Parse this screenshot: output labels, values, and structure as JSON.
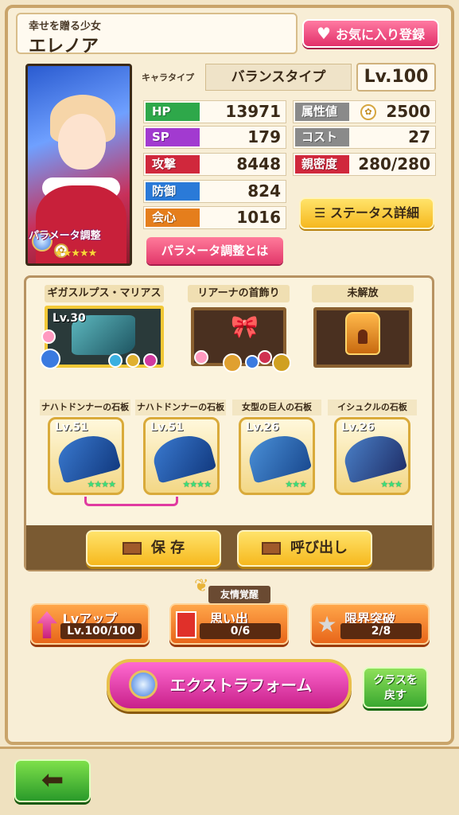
{
  "header": {
    "subtitle": "幸せを贈る少女",
    "name": "エレノア",
    "favorite_label": "お気に入り登録"
  },
  "portrait": {
    "param_label": "パラメータ調整",
    "stars": "★★★★★"
  },
  "profile": {
    "type_label": "キャラタイプ",
    "type_value": "バランスタイプ",
    "level": "Lv.100"
  },
  "stats": {
    "hp": {
      "label": "HP",
      "value": "13971"
    },
    "sp": {
      "label": "SP",
      "value": "179"
    },
    "atk": {
      "label": "攻撃",
      "value": "8448"
    },
    "def": {
      "label": "防御",
      "value": "824"
    },
    "crit": {
      "label": "会心",
      "value": "1016"
    },
    "attr": {
      "label": "属性値",
      "value": "2500"
    },
    "cost": {
      "label": "コスト",
      "value": "27"
    },
    "affinity": {
      "label": "親密度",
      "value": "280/280"
    }
  },
  "buttons": {
    "param_about": "パラメータ調整とは",
    "status_detail": "ステータス詳細",
    "save": "保 存",
    "call": "呼び出し",
    "lvup": "Lvアップ",
    "lvup_sub": "Lv.100/100",
    "memory": "思い出",
    "memory_sub": "0/6",
    "limit": "限界突破",
    "limit_sub": "2/8",
    "extra_form": "エクストラフォーム",
    "class_return_1": "クラスを",
    "class_return_2": "戻す",
    "back": "⬅"
  },
  "equipment": {
    "weapon": {
      "title": "ギガスルプス・マリアス",
      "level": "Lv.30"
    },
    "accessory": {
      "title": "リアーナの首飾り"
    },
    "locked": {
      "title": "未解放"
    }
  },
  "stones": [
    {
      "title": "ナハトドンナーの石板",
      "level": "Lv.51",
      "stars": "★★★★"
    },
    {
      "title": "ナハトドンナーの石板",
      "level": "Lv.51",
      "stars": "★★★★"
    },
    {
      "title": "女型の巨人の石板",
      "level": "Lv.26",
      "stars": "★★★"
    },
    {
      "title": "イシュクルの石板",
      "level": "Lv.26",
      "stars": "★★★"
    }
  ],
  "friendship": {
    "label": "友情覚醒"
  }
}
